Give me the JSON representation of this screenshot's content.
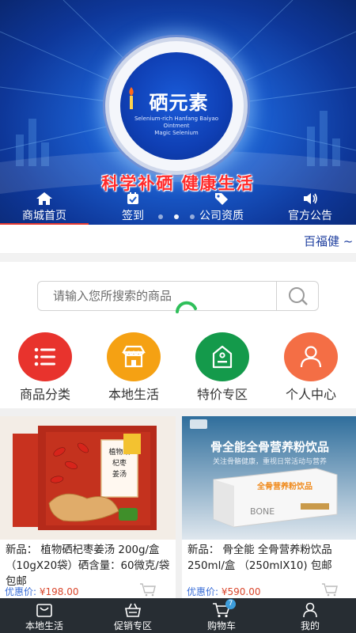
{
  "banner": {
    "logo_title": "硒元素",
    "logo_subtitle_line1": "Selenium-rich Hanfang Baiyao Ointment",
    "logo_subtitle_line2": "Magic Selenium",
    "slogan": "科学补硒  健康生活",
    "nav": [
      {
        "label": "商城首页",
        "icon": "home-icon"
      },
      {
        "label": "签到",
        "icon": "sign-in-icon"
      },
      {
        "label": "公司资质",
        "icon": "tag-icon"
      },
      {
        "label": "官方公告",
        "icon": "speaker-icon"
      }
    ],
    "active_slide": 1,
    "slide_count": 3
  },
  "marquee": {
    "text": "百福健 ~"
  },
  "search": {
    "placeholder": "请输入您所搜索的商品",
    "value": ""
  },
  "categories": [
    {
      "label": "商品分类",
      "icon": "list-icon",
      "color": "#e8332d"
    },
    {
      "label": "本地生活",
      "icon": "shop-icon",
      "color": "#f5a113"
    },
    {
      "label": "特价专区",
      "icon": "price-tag-icon",
      "color": "#149a4b"
    },
    {
      "label": "个人中心",
      "icon": "user-icon",
      "color": "#f46e45"
    }
  ],
  "products": [
    {
      "name": "新品：  植物硒杞枣姜汤 200g/盒（10gX20袋）硒含量：60微克/袋 包邮",
      "price_label": "优惠价:",
      "price": "¥198.00",
      "box_text": "植物硒杞枣姜汤"
    },
    {
      "name": "新品：  骨全能 全骨营养粉饮品 250ml/盒 （250mlX10) 包邮",
      "price_label": "优惠价:",
      "price": "¥590.00",
      "ad_title": "骨全能全骨营养粉饮品",
      "ad_subtitle": "关注骨骼健康，重视日常活动与营养",
      "box_text": "全骨营养粉饮品",
      "brand": "BONE"
    }
  ],
  "tabbar": [
    {
      "label": "本地生活",
      "icon": "local-life-icon"
    },
    {
      "label": "促销专区",
      "icon": "basket-icon"
    },
    {
      "label": "购物车",
      "icon": "cart-icon",
      "badge": "7"
    },
    {
      "label": "我的",
      "icon": "profile-icon"
    }
  ],
  "colors": {
    "accent": "#e83a30",
    "tabbar": "#272d33",
    "price": "#d9462c",
    "marquee": "#1f3f9f"
  }
}
